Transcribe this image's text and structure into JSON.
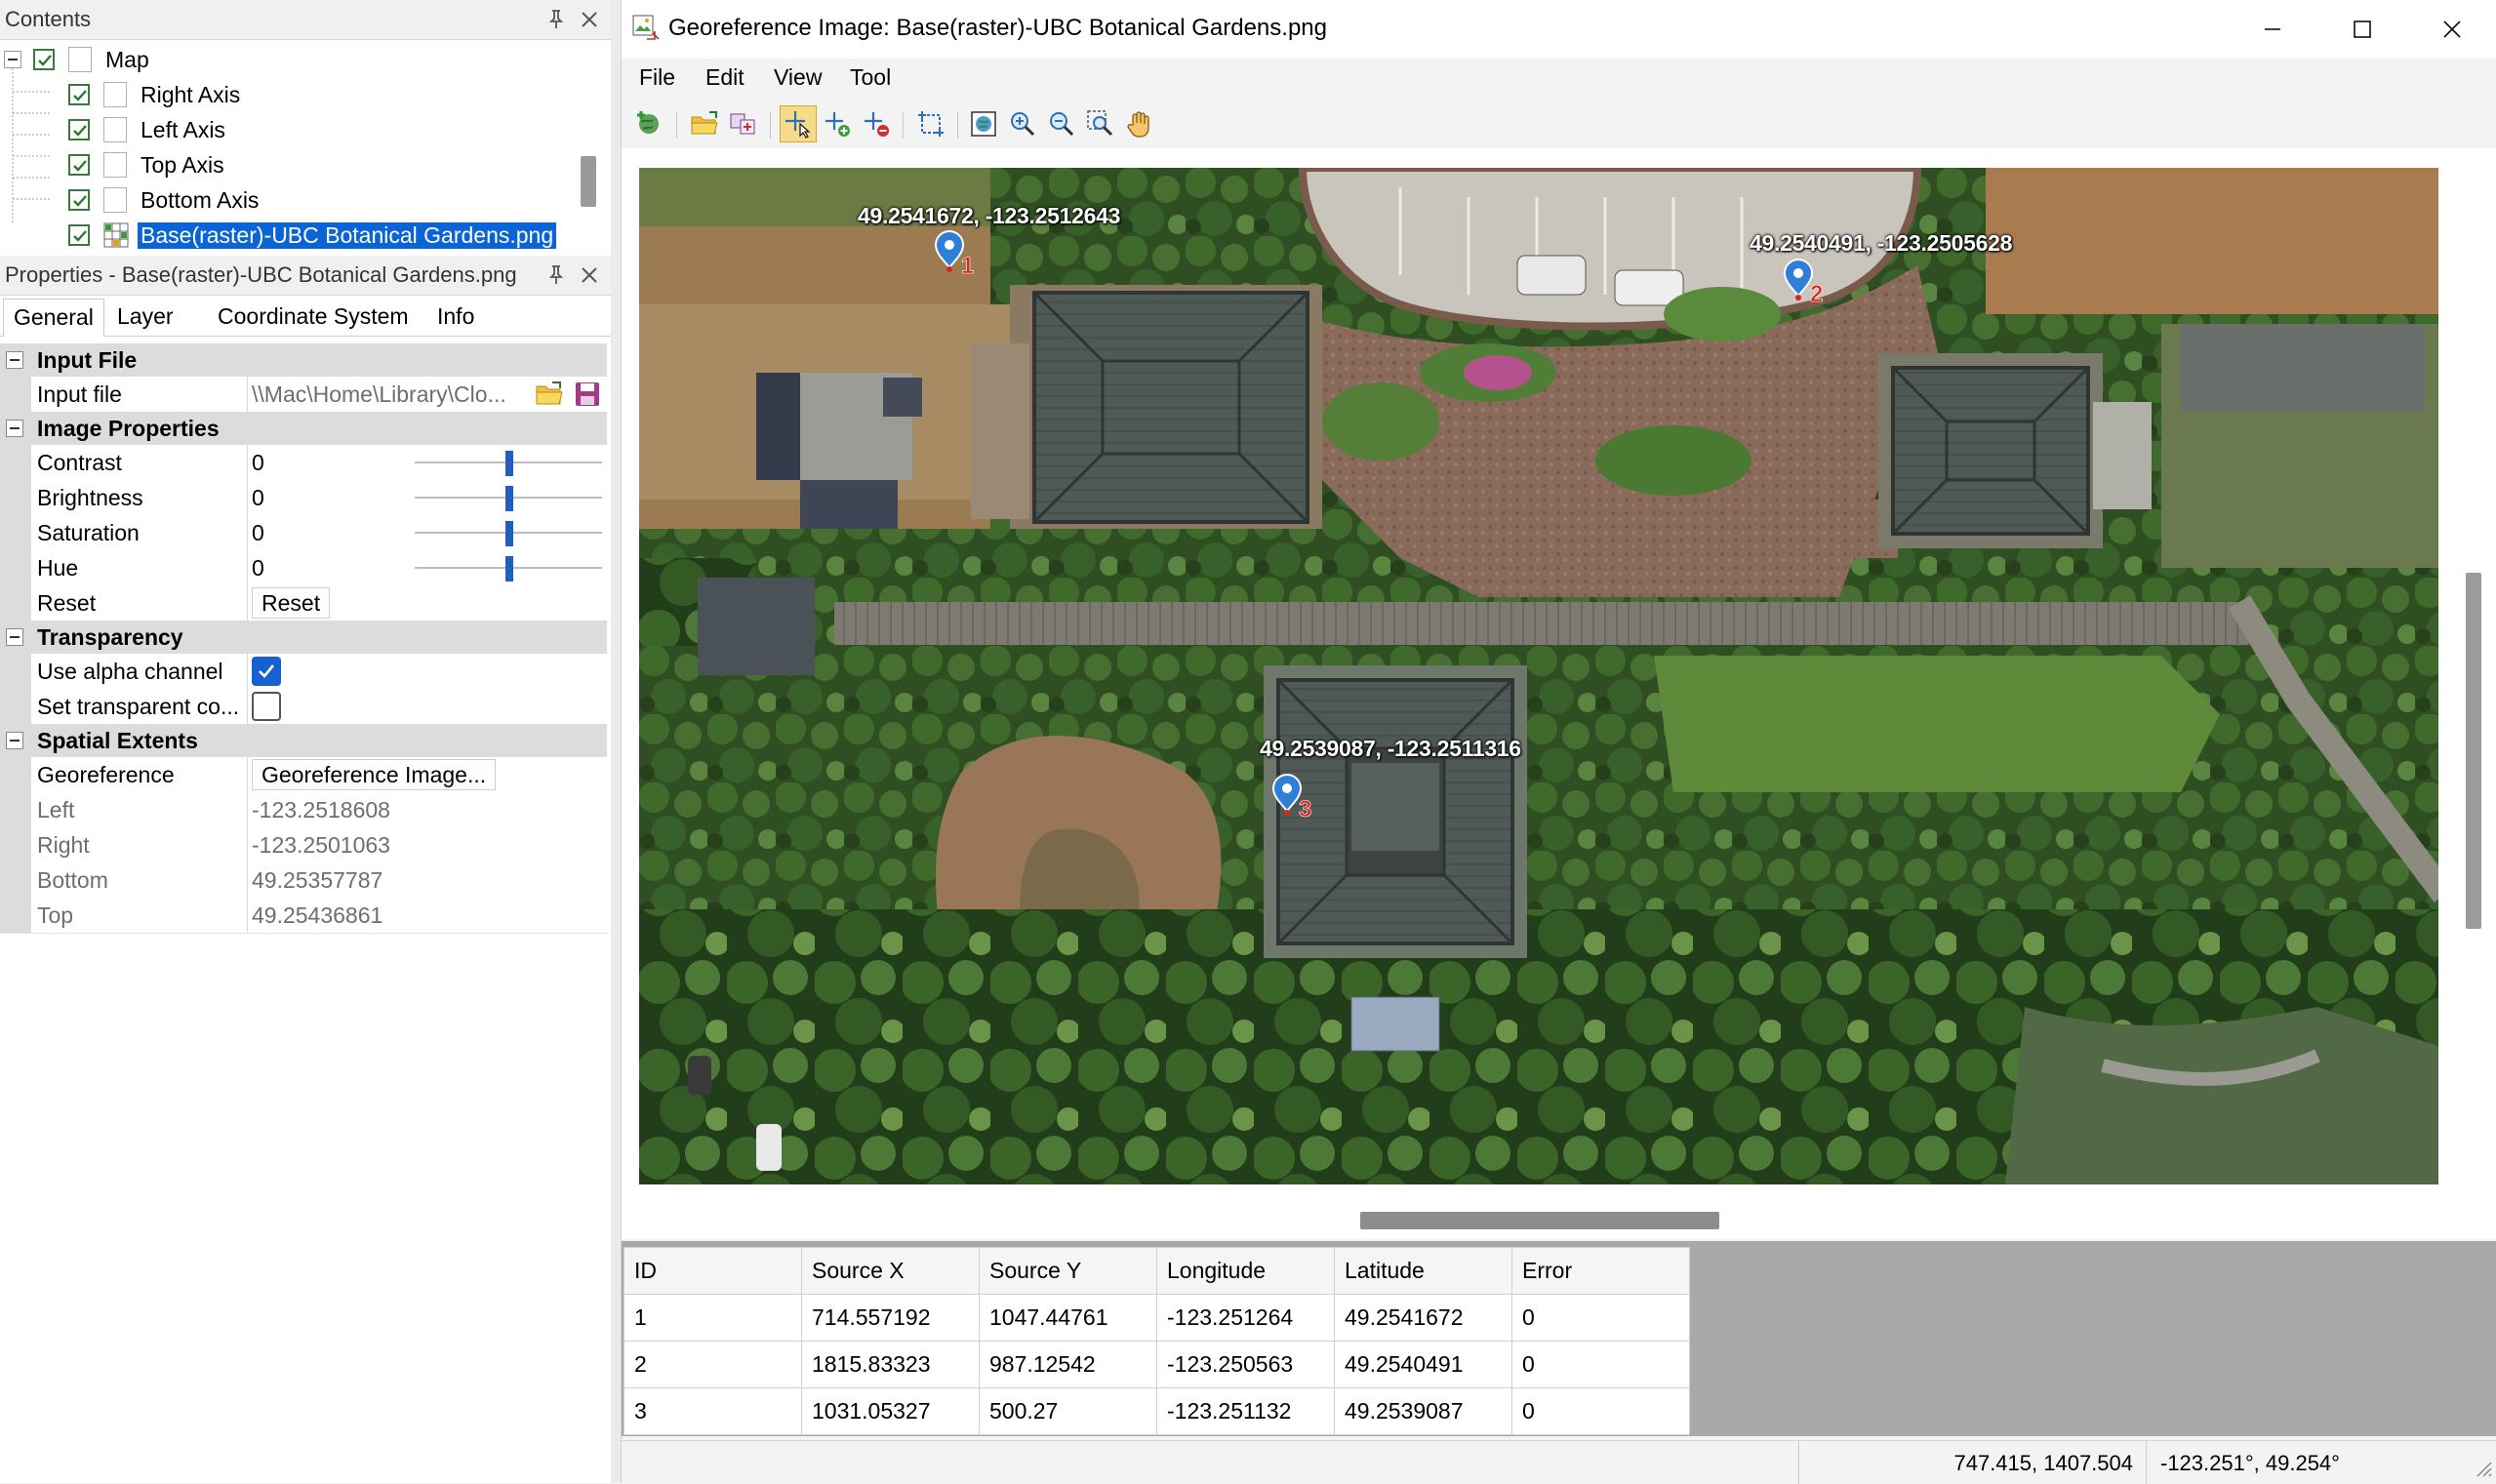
{
  "contents": {
    "title": "Contents",
    "tree": {
      "root": "Map",
      "layers": [
        "Right Axis",
        "Left Axis",
        "Top Axis",
        "Bottom Axis",
        "Base(raster)-UBC Botanical Gardens.png"
      ]
    }
  },
  "properties": {
    "title": "Properties - Base(raster)-UBC Botanical Gardens.png",
    "tabs": [
      "General",
      "Layer",
      "Coordinate System",
      "Info"
    ],
    "sections": {
      "input_file": "Input File",
      "image_properties": "Image Properties",
      "transparency": "Transparency",
      "spatial_extents": "Spatial Extents"
    },
    "input_file": {
      "label": "Input file",
      "value": "\\\\Mac\\Home\\Library\\Clo..."
    },
    "image": {
      "contrast_label": "Contrast",
      "contrast": "0",
      "brightness_label": "Brightness",
      "brightness": "0",
      "saturation_label": "Saturation",
      "saturation": "0",
      "hue_label": "Hue",
      "hue": "0",
      "reset_label": "Reset",
      "reset_button": "Reset"
    },
    "transparency": {
      "alpha_label": "Use alpha channel",
      "alpha_checked": true,
      "transparent_label": "Set transparent co...",
      "transparent_checked": false
    },
    "extents": {
      "georeference_label": "Georeference",
      "georeference_button": "Georeference Image...",
      "left_label": "Left",
      "left": "-123.2518608",
      "right_label": "Right",
      "right": "-123.2501063",
      "bottom_label": "Bottom",
      "bottom": "49.25357787",
      "top_label": "Top",
      "top": "49.25436861"
    }
  },
  "window": {
    "title": "Georeference Image: Base(raster)-UBC Botanical Gardens.png",
    "menu": [
      "File",
      "Edit",
      "View",
      "Tool"
    ],
    "toolbar_icons": [
      "add-data-icon",
      "open-folder-icon",
      "export-icon",
      "select-point-icon",
      "add-point-icon",
      "remove-point-icon",
      "transform-icon",
      "full-extent-icon",
      "zoom-in-icon",
      "zoom-out-icon",
      "zoom-box-icon",
      "pan-hand-icon"
    ]
  },
  "map": {
    "points": [
      {
        "id": "1",
        "label": "49.2541672, -123.2512643"
      },
      {
        "id": "2",
        "label": "49.2540491, -123.2505628"
      },
      {
        "id": "3",
        "label": "49.2539087, -123.2511316"
      }
    ]
  },
  "gcp_table": {
    "headers": [
      "ID",
      "Source X",
      "Source Y",
      "Longitude",
      "Latitude",
      "Error"
    ],
    "rows": [
      [
        "1",
        "714.557192",
        "1047.44761",
        "-123.251264",
        "49.2541672",
        "0"
      ],
      [
        "2",
        "1815.83323",
        "987.12542",
        "-123.250563",
        "49.2540491",
        "0"
      ],
      [
        "3",
        "1031.05327",
        "500.27",
        "-123.251132",
        "49.2539087",
        "0"
      ]
    ]
  },
  "status": {
    "pixel_coords": "747.415, 1407.504",
    "geo_coords": "-123.251°, 49.254°"
  },
  "colors": {
    "selection": "#0a64d6",
    "marker": "#2f7fd8",
    "marker_number": "#e0201a",
    "checkbox_checked": "#1760d0"
  }
}
